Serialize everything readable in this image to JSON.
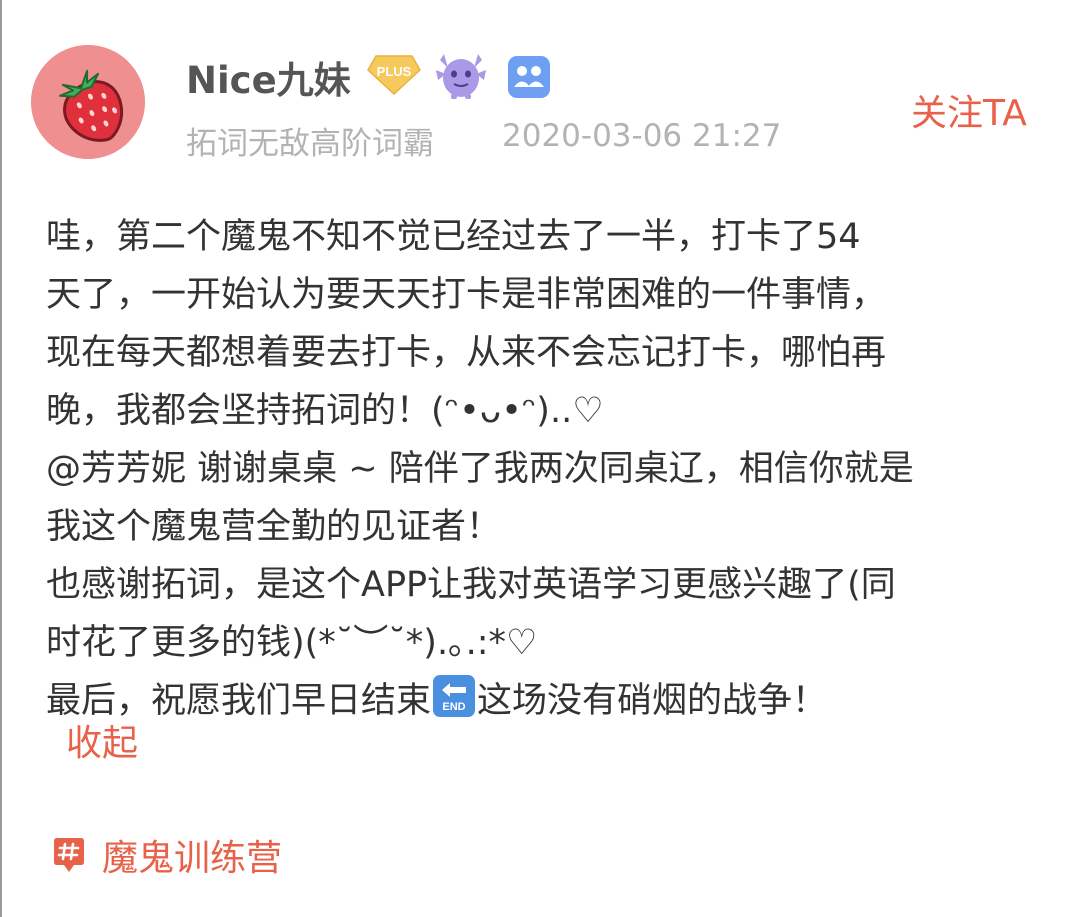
{
  "author": {
    "name": "Nice九妹",
    "title": "拓词无敌高阶词霸",
    "timestamp": "2020-03-06 21:27",
    "badges": [
      "plus-badge",
      "monster-badge",
      "deskmate-badge"
    ],
    "plus_label": "PLUS"
  },
  "follow_label": "关注TA",
  "post": {
    "lines": [
      "哇，第二个魔鬼不知不觉已经过去了一半，打卡了54",
      "天了，一开始认为要天天打卡是非常困难的一件事情，",
      "现在每天都想着要去打卡，从来不会忘记打卡，哪怕再",
      "晚，我都会坚持拓词的！(ᵔ•ᴗ•ᵔ)..♡",
      "@芳芳妮  谢谢桌桌 ~ 陪伴了我两次同桌辽，相信你就是",
      "我这个魔鬼营全勤的见证者！",
      "也感谢拓词，是这个APP让我对英语学习更感兴趣了(同",
      "时花了更多的钱)(*˘︶˘*).｡.:*♡"
    ],
    "last_line_before_emoji": "最后，祝愿我们早日结束",
    "emoji_name": "end-arrow-icon",
    "emoji_text": "END",
    "last_line_after_emoji": "这场没有硝烟的战争！"
  },
  "collapse_label": "收起",
  "topic": {
    "label": "魔鬼训练营",
    "icon": "hashtag-icon"
  },
  "colors": {
    "accent": "#e8624a",
    "avatar_bg": "#f08f8f",
    "text": "#333333",
    "muted": "#b3b3b3",
    "plus_badge": "#f6c95d",
    "monster_badge": "#a999e6",
    "desk_badge": "#6e9ff2",
    "end_emoji": "#4a8fe0"
  }
}
